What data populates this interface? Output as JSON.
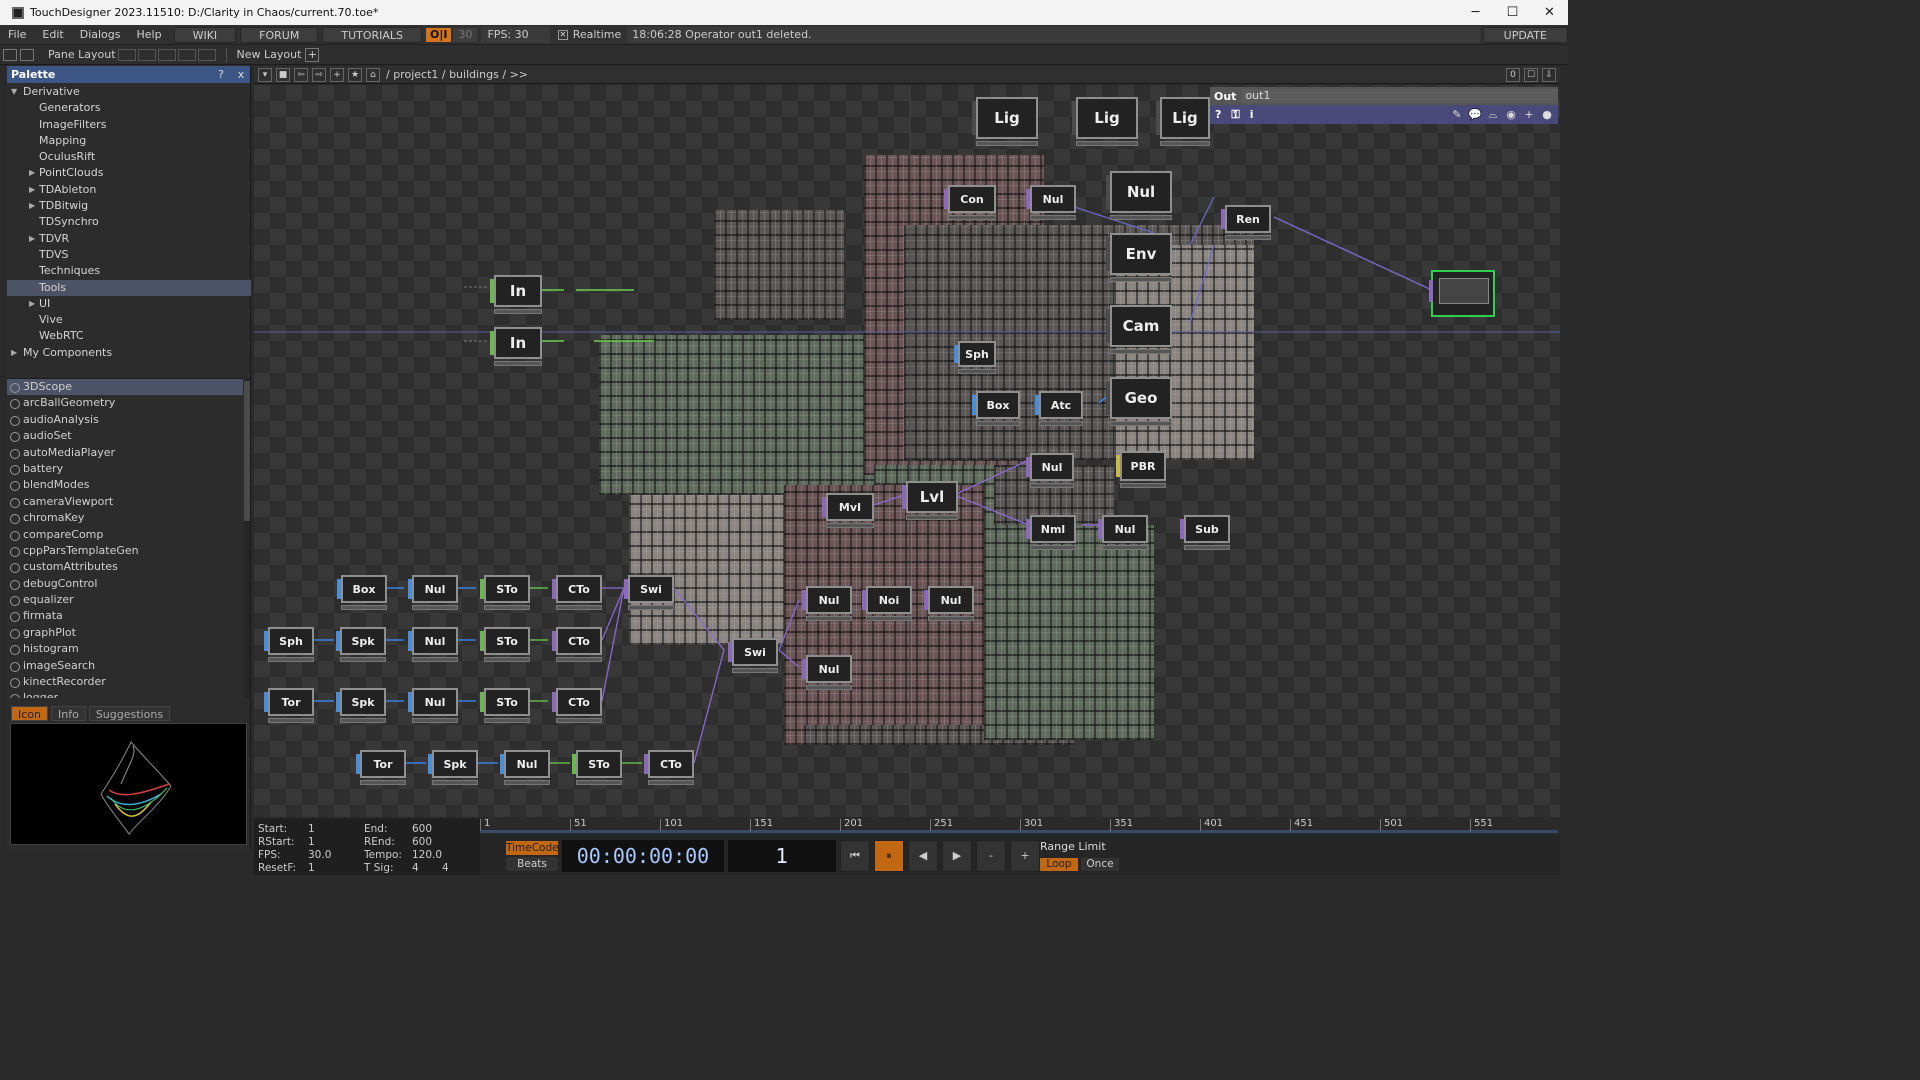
{
  "window": {
    "title": "TouchDesigner 2023.11510: D:/Clarity in Chaos/current.70.toe*",
    "min": "─",
    "max": "☐",
    "close": "✕"
  },
  "menu": {
    "items": [
      "File",
      "Edit",
      "Dialogs",
      "Help"
    ],
    "wiki": "WIKI",
    "forum": "FORUM",
    "tutorials": "TUTORIALS",
    "oi": "O|I",
    "thirty": "30",
    "fps_label": "FPS:  30",
    "realtime": "Realtime",
    "status": "18:06:28 Operator out1 deleted.",
    "update": "UPDATE"
  },
  "layoutbar": {
    "pane_layout": "Pane Layout",
    "new_layout": "New Layout",
    "plus": "+"
  },
  "palette": {
    "title": "Palette",
    "help": "?",
    "close": "x",
    "tree": [
      {
        "label": "Derivative",
        "level": 0,
        "arrow": "▼"
      },
      {
        "label": "Generators",
        "level": 2,
        "arrow": ""
      },
      {
        "label": "ImageFilters",
        "level": 2,
        "arrow": ""
      },
      {
        "label": "Mapping",
        "level": 2,
        "arrow": ""
      },
      {
        "label": "OculusRift",
        "level": 2,
        "arrow": ""
      },
      {
        "label": "PointClouds",
        "level": 1,
        "arrow": "▶"
      },
      {
        "label": "TDAbleton",
        "level": 1,
        "arrow": "▶"
      },
      {
        "label": "TDBitwig",
        "level": 1,
        "arrow": "▶"
      },
      {
        "label": "TDSynchro",
        "level": 2,
        "arrow": ""
      },
      {
        "label": "TDVR",
        "level": 1,
        "arrow": "▶"
      },
      {
        "label": "TDVS",
        "level": 2,
        "arrow": ""
      },
      {
        "label": "Techniques",
        "level": 2,
        "arrow": ""
      },
      {
        "label": "Tools",
        "level": 2,
        "arrow": "",
        "selected": true
      },
      {
        "label": "UI",
        "level": 1,
        "arrow": "▶"
      },
      {
        "label": "Vive",
        "level": 2,
        "arrow": ""
      },
      {
        "label": "WebRTC",
        "level": 2,
        "arrow": ""
      },
      {
        "label": "My Components",
        "level": -1,
        "arrow": "▶"
      }
    ],
    "components": [
      "3DScope",
      "arcBallGeometry",
      "audioAnalysis",
      "audioSet",
      "autoMediaPlayer",
      "battery",
      "blendModes",
      "cameraViewport",
      "chromaKey",
      "compareComp",
      "cppParsTemplateGen",
      "customAttributes",
      "debugControl",
      "equalizer",
      "firmata",
      "graphPlot",
      "histogram",
      "imageSearch",
      "kinectRecorder",
      "logger"
    ],
    "tabs": [
      "Icon",
      "Info",
      "Suggestions"
    ]
  },
  "network": {
    "path": "/ project1 / buildings / >>",
    "right_btns": [
      "0",
      "☐",
      "⇩"
    ],
    "nodes": [
      {
        "label": "Lig",
        "color": "#4b4b4b",
        "size": "big"
      },
      {
        "label": "Lig",
        "color": "#4b4b4b",
        "size": "big"
      },
      {
        "label": "Lig",
        "color": "#4b4b4b",
        "size": "big"
      },
      {
        "label": "Nul",
        "color": "#4b4b4b",
        "size": "big"
      },
      {
        "label": "Env",
        "color": "#4b4b4b",
        "size": "big"
      },
      {
        "label": "Cam",
        "color": "#4b4b4b",
        "size": "big"
      },
      {
        "label": "Geo",
        "color": "#4b4b4b",
        "size": "big"
      },
      {
        "label": "Con",
        "color": "#8a6ab8",
        "size": "small"
      },
      {
        "label": "Nul",
        "color": "#8a6ab8",
        "size": "small"
      },
      {
        "label": "Ren",
        "color": "#8a6ab8",
        "size": "small"
      },
      {
        "label": "In",
        "color": "#6ab84f",
        "size": "big"
      },
      {
        "label": "In",
        "color": "#6ab84f",
        "size": "big"
      },
      {
        "label": "Sph",
        "color": "#4a8ed8",
        "size": "small"
      },
      {
        "label": "Box",
        "color": "#4a8ed8",
        "size": "small"
      },
      {
        "label": "Atc",
        "color": "#4a8ed8",
        "size": "small"
      },
      {
        "label": "Nul",
        "color": "#8a6ab8",
        "size": "small"
      },
      {
        "label": "PBR",
        "color": "#c8b84a",
        "size": "small"
      },
      {
        "label": "MvI",
        "color": "#8a6ab8",
        "size": "small"
      },
      {
        "label": "Lvl",
        "color": "#8a6ab8",
        "size": "big"
      },
      {
        "label": "Nml",
        "color": "#8a6ab8",
        "size": "small"
      },
      {
        "label": "Nul",
        "color": "#8a6ab8",
        "size": "small"
      },
      {
        "label": "Sub",
        "color": "#8a6ab8",
        "size": "small"
      },
      {
        "label": "Box",
        "color": "#4a8ed8",
        "size": "small"
      },
      {
        "label": "Nul",
        "color": "#4a8ed8",
        "size": "small"
      },
      {
        "label": "STo",
        "color": "#6ab84f",
        "size": "small"
      },
      {
        "label": "CTo",
        "color": "#8a6ab8",
        "size": "small"
      },
      {
        "label": "Swi",
        "color": "#8a6ab8",
        "size": "small"
      },
      {
        "label": "Sph",
        "color": "#4a8ed8",
        "size": "small"
      },
      {
        "label": "Spk",
        "color": "#4a8ed8",
        "size": "small"
      },
      {
        "label": "Nul",
        "color": "#4a8ed8",
        "size": "small"
      },
      {
        "label": "STo",
        "color": "#6ab84f",
        "size": "small"
      },
      {
        "label": "CTo",
        "color": "#8a6ab8",
        "size": "small"
      },
      {
        "label": "Swi",
        "color": "#8a6ab8",
        "size": "small"
      },
      {
        "label": "Nul",
        "color": "#8a6ab8",
        "size": "small"
      },
      {
        "label": "Noi",
        "color": "#8a6ab8",
        "size": "small"
      },
      {
        "label": "Nul",
        "color": "#8a6ab8",
        "size": "small"
      },
      {
        "label": "Nul",
        "color": "#8a6ab8",
        "size": "small"
      },
      {
        "label": "Tor",
        "color": "#4a8ed8",
        "size": "small"
      },
      {
        "label": "Spk",
        "color": "#4a8ed8",
        "size": "small"
      },
      {
        "label": "Nul",
        "color": "#4a8ed8",
        "size": "small"
      },
      {
        "label": "STo",
        "color": "#6ab84f",
        "size": "small"
      },
      {
        "label": "CTo",
        "color": "#8a6ab8",
        "size": "small"
      },
      {
        "label": "Tor",
        "color": "#4a8ed8",
        "size": "small"
      },
      {
        "label": "Spk",
        "color": "#4a8ed8",
        "size": "small"
      },
      {
        "label": "Nul",
        "color": "#4a8ed8",
        "size": "small"
      },
      {
        "label": "STo",
        "color": "#6ab84f",
        "size": "small"
      },
      {
        "label": "CTo",
        "color": "#8a6ab8",
        "size": "small"
      }
    ],
    "out_panel": {
      "op_type": "Out",
      "op_name": "out1",
      "help": "?",
      "info": "i"
    }
  },
  "timeline": {
    "start_label": "Start:",
    "start": "1",
    "rstart_label": "RStart:",
    "rstart": "1",
    "fps_label": "FPS:",
    "fps": "30.0",
    "resetf_label": "ResetF:",
    "resetf": "1",
    "end_label": "End:",
    "end": "600",
    "rend_label": "REnd:",
    "rend": "600",
    "tempo_label": "Tempo:",
    "tempo": "120.0",
    "tsig_label": "T Sig:",
    "tsig_a": "4",
    "tsig_b": "4",
    "ruler_ticks": [
      "1",
      "51",
      "101",
      "151",
      "201",
      "251",
      "301",
      "351",
      "401",
      "451",
      "501",
      "551"
    ],
    "timecode": "TimeCode",
    "beats": "Beats",
    "time": "00:00:00:00",
    "frame": "1",
    "range_limit": "Range Limit",
    "loop": "Loop",
    "once": "Once",
    "controls": [
      "⏮",
      "⏸",
      "◀",
      "▶",
      "-",
      "+"
    ]
  },
  "colors": {
    "accent": "#c26813",
    "palette_header": "#3e5686",
    "selected_row": "#4c5366"
  }
}
